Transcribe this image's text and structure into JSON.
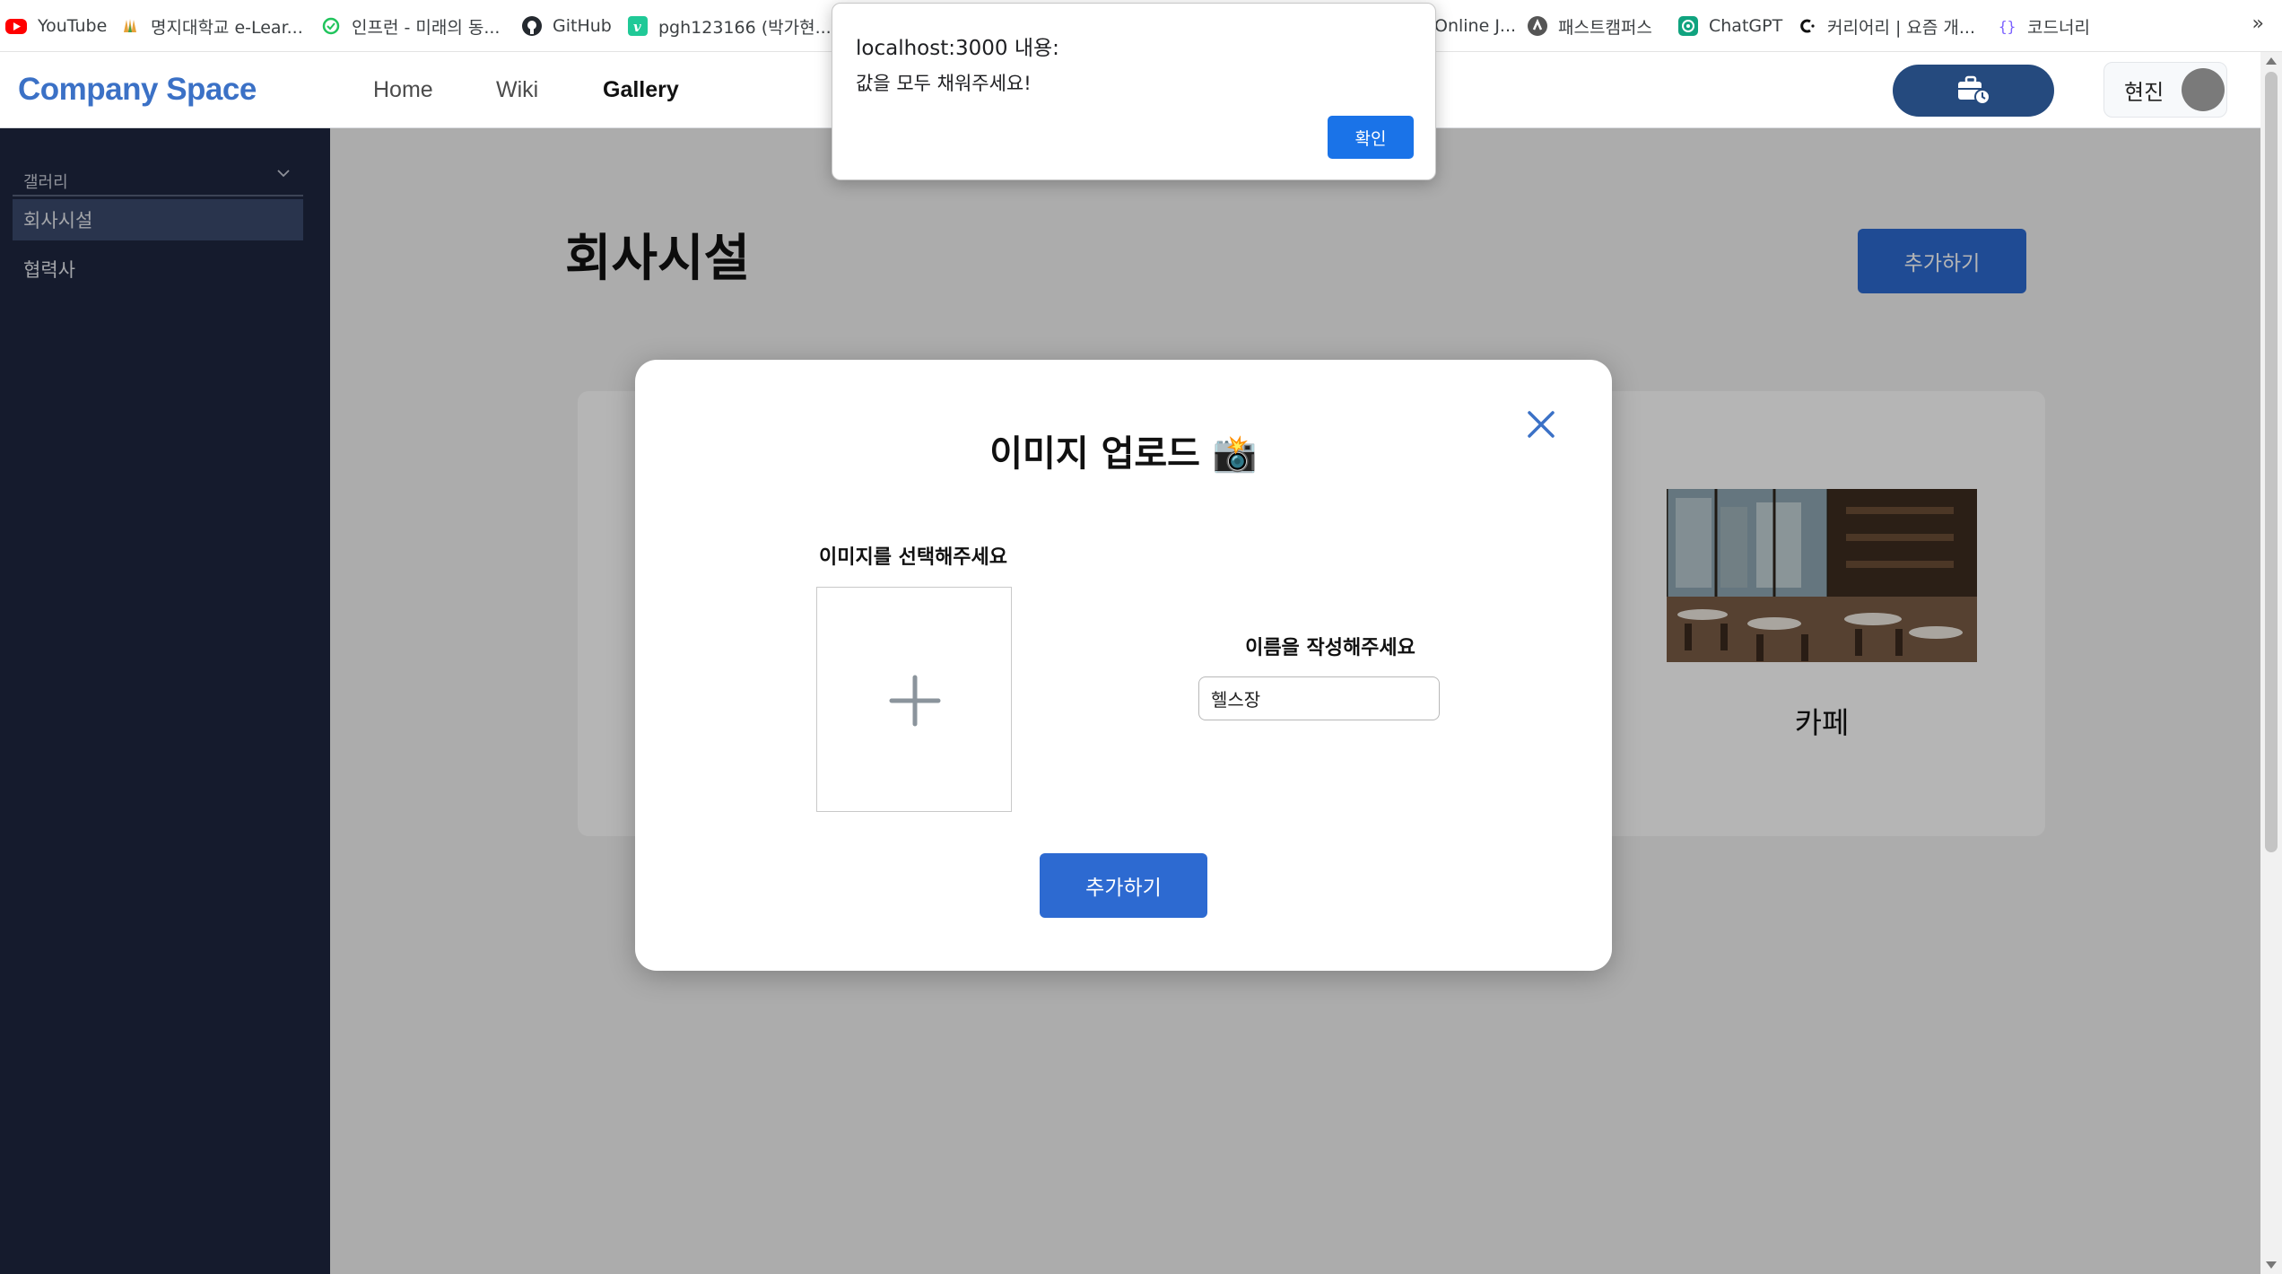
{
  "bookmarks": {
    "items": [
      {
        "label": "YouTube",
        "icon": "youtube-icon",
        "color": "#ff0000"
      },
      {
        "label": "명지대학교 e-Lear...",
        "icon": "mju-icon",
        "color": "#e8a23a"
      },
      {
        "label": "인프런 - 미래의 동...",
        "icon": "inflearn-icon",
        "color": "#21c45d"
      },
      {
        "label": "GitHub",
        "icon": "github-icon",
        "color": "#24292f"
      },
      {
        "label": "pgh123166 (박가현...",
        "icon": "velog-icon",
        "color": "#20c997"
      },
      {
        "label": "Online J...",
        "icon": "",
        "color": ""
      },
      {
        "label": "패스트캠퍼스",
        "icon": "fastcampus-icon",
        "color": "#555555"
      },
      {
        "label": "ChatGPT",
        "icon": "chatgpt-icon",
        "color": "#10a37f"
      },
      {
        "label": "커리어리 | 요즘 개...",
        "icon": "careerly-icon",
        "color": "#111111"
      },
      {
        "label": "코드너리",
        "icon": "codenary-icon",
        "color": "#7b61ff"
      }
    ],
    "more": "»"
  },
  "nav": {
    "logo": "Company Space",
    "links": [
      "Home",
      "Wiki",
      "Gallery"
    ],
    "active": "Gallery",
    "user_name": "현진"
  },
  "sidebar": {
    "group_label": "갤러리",
    "items": [
      {
        "label": "회사시설",
        "active": true
      },
      {
        "label": "협력사",
        "active": false
      }
    ]
  },
  "main": {
    "title": "회사시설",
    "add_button": "추가하기",
    "cards": [
      {
        "caption": "카페"
      }
    ]
  },
  "modal": {
    "title": "이미지 업로드",
    "title_emoji": "📸",
    "image_label": "이미지를 선택해주세요",
    "name_label": "이름을 작성해주세요",
    "name_value": "헬스장",
    "submit": "추가하기"
  },
  "alert": {
    "title": "localhost:3000 내용:",
    "message": "값을 모두 채워주세요!",
    "ok": "확인"
  },
  "colors": {
    "brand": "#3b71c6",
    "primary_button": "#2d6ad1",
    "sidebar_bg": "#1e2640",
    "attendance_button": "#254a7e",
    "alert_button": "#1a73e8"
  }
}
